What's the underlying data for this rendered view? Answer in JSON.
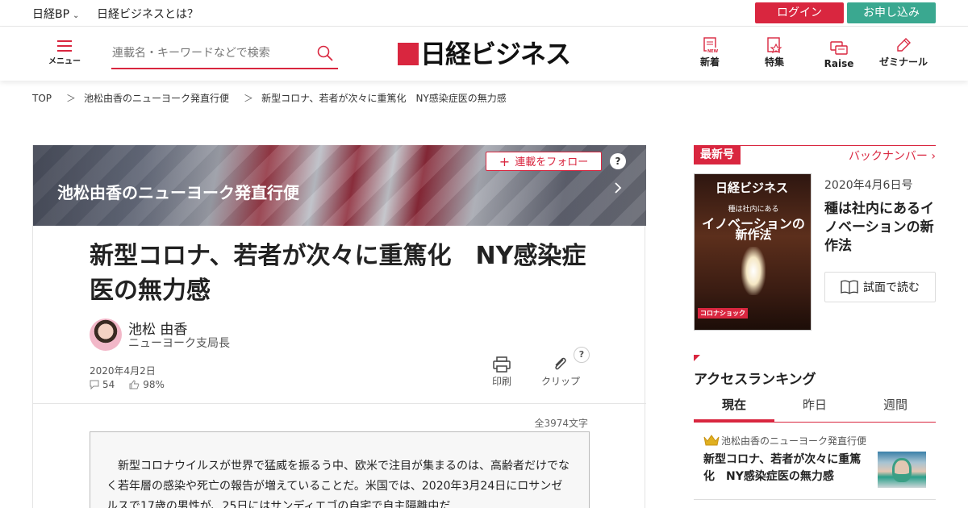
{
  "topbar": {
    "nikkei_bp": "日経BP",
    "about": "日経ビジネスとは？",
    "login": "ログイン",
    "apply": "お申し込み"
  },
  "header": {
    "menu_label": "メニュー",
    "search_placeholder": "連載名・キーワードなどで検索",
    "logo_text": "日経ビジネス",
    "nav": [
      {
        "label": "新着",
        "icon": "new-icon"
      },
      {
        "label": "特集",
        "icon": "feature-icon"
      },
      {
        "label": "Raise",
        "icon": "raise-icon"
      },
      {
        "label": "ゼミナール",
        "icon": "seminar-icon"
      }
    ]
  },
  "breadcrumb": [
    "TOP",
    "池松由香のニューヨーク発直行便",
    "新型コロナ、若者が次々に重篤化　NY感染症医の無力感"
  ],
  "breadcrumb_sep": "＞",
  "article": {
    "series_title": "池松由香のニューヨーク発直行便",
    "follow_label": "連載をフォロー",
    "help": "?",
    "title": "新型コロナ、若者が次々に重篤化　NY感染症医の無力感",
    "author_name": "池松 由香",
    "author_title": "ニューヨーク支局長",
    "date": "2020年4月2日",
    "comments": "54",
    "likes": "98%",
    "print_label": "印刷",
    "clip_label": "クリップ",
    "char_count": "全3974文字",
    "lead": "　新型コロナウイルスが世界で猛威を振るう中、欧米で注目が集まるのは、高齢者だけでなく若年層の感染や死亡の報告が増えていることだ。米国では、2020年3月24日にロサンゼルスで17歳の男性が、25日にはサンディエゴの自宅で自主隔離中だ"
  },
  "sidebar": {
    "latest_tag": "最新号",
    "back_numbers": "バックナンバー",
    "cover": {
      "magazine": "日経ビジネス",
      "line1": "種は社内にある",
      "line2": "イノベーションの",
      "line3": "新作法",
      "badge": "コロナショック"
    },
    "issue_date": "2020年4月6日号",
    "issue_title": "種は社内にあるイノベーションの新作法",
    "trial_label": "試面で読む",
    "ranking_title": "アクセスランキング",
    "tabs": [
      "現在",
      "昨日",
      "週間"
    ],
    "top_item": {
      "series": "池松由香のニューヨーク発直行便",
      "title": "新型コロナ、若者が次々に重篤化　NY感染症医の無力感"
    }
  },
  "colors": {
    "brand_red": "#d9263f",
    "apply_green": "#3aa890"
  }
}
